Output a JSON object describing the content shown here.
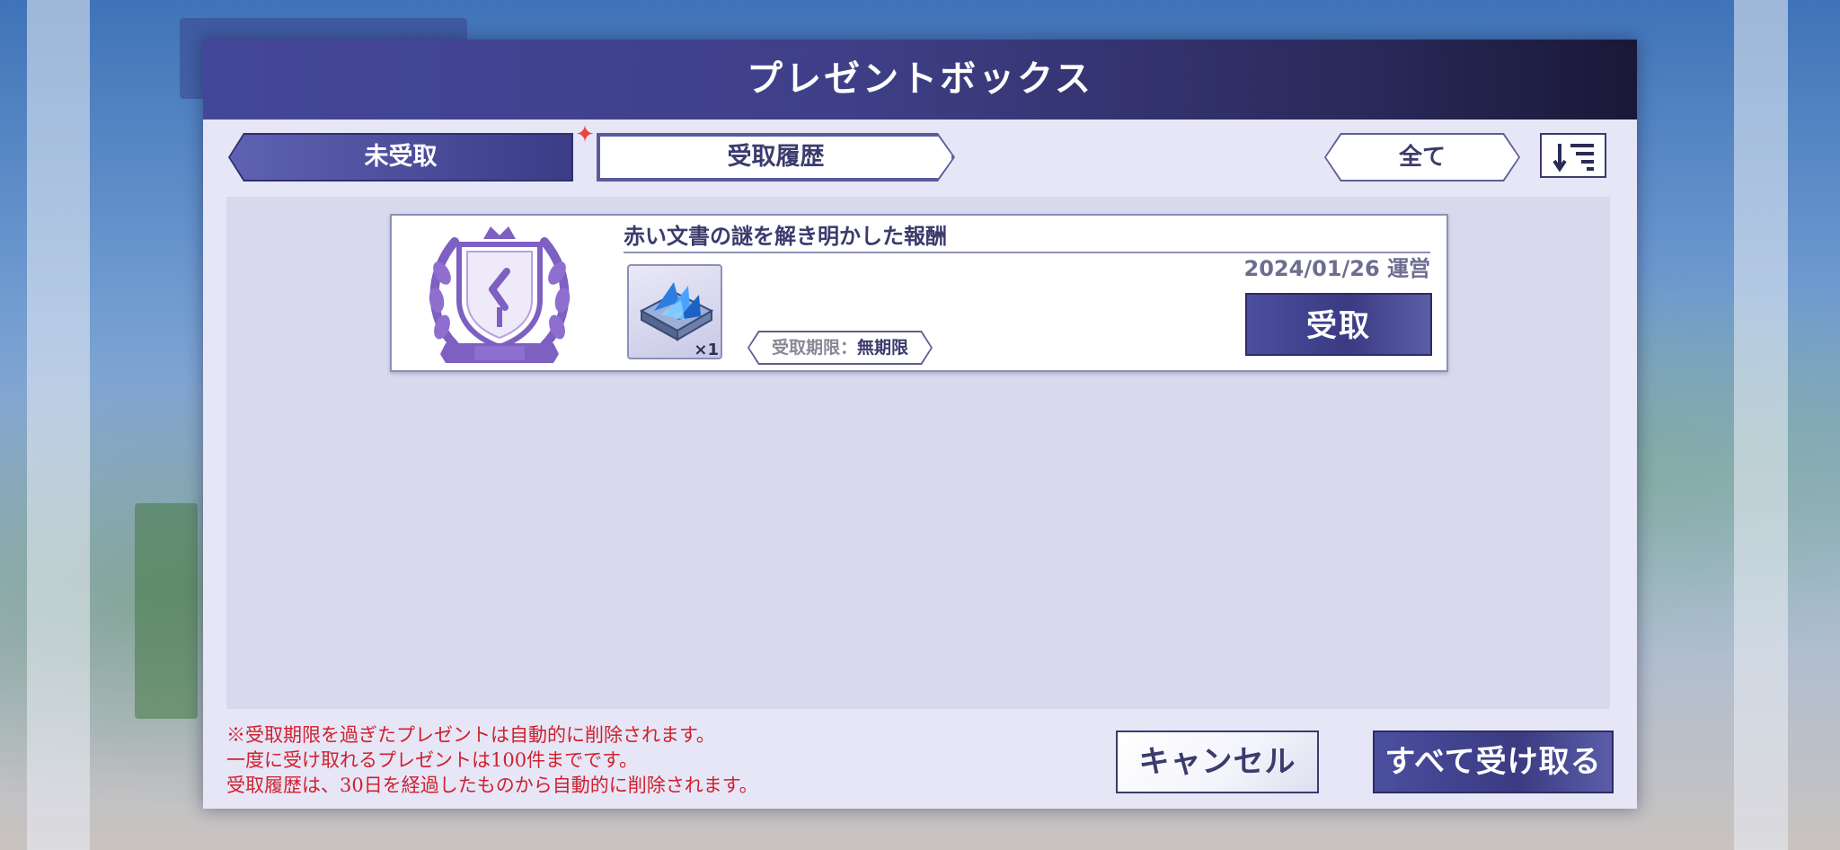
{
  "dialog": {
    "title": "プレゼントボックス"
  },
  "tabs": [
    {
      "label": "未受取",
      "active": true,
      "has_badge": true
    },
    {
      "label": "受取履歴",
      "active": false
    }
  ],
  "filter": {
    "label": "全て"
  },
  "sort": {
    "icon": "sort-descending-icon"
  },
  "presents": [
    {
      "title": "赤い文書の謎を解き明かした報酬",
      "date": "2024/01/26",
      "sender": "運営",
      "item_icon": "crystal-box-icon",
      "quantity": "×1",
      "deadline_label": "受取期限：",
      "deadline_value": "無期限",
      "receive_label": "受取"
    }
  ],
  "notes": [
    "※受取期限を過ぎたプレゼントは自動的に削除されます。",
    "一度に受け取れるプレゼントは100件までです。",
    "受取履歴は、30日を経過したものから自動的に削除されます。"
  ],
  "buttons": {
    "cancel": "キャンセル",
    "receive_all": "すべて受け取る"
  },
  "colors": {
    "accent": "#3b3c86",
    "notice": "#d0212f",
    "badge": "#e8463a"
  }
}
